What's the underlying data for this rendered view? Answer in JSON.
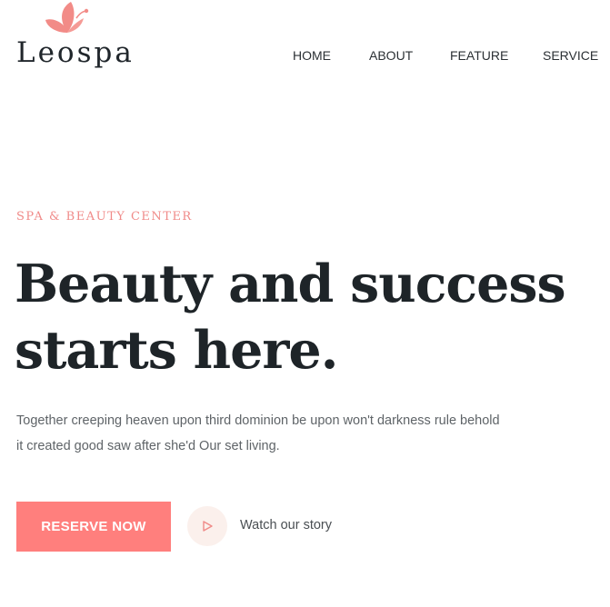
{
  "brand": {
    "name": "Leospa",
    "accent_color": "#ff7f7d",
    "logo_icon": "butterfly-icon"
  },
  "nav": {
    "items": [
      {
        "label": "HOME"
      },
      {
        "label": "ABOUT"
      },
      {
        "label": "FEATURE"
      },
      {
        "label": "SERVICE"
      }
    ]
  },
  "hero": {
    "eyebrow": "SPA & BEAUTY CENTER",
    "headline_line1": "Beauty and success",
    "headline_line2": "starts here.",
    "lede_line1": "Together creeping heaven upon third dominion be upon won't darkness rule behold",
    "lede_line2": "it created good saw after she'd Our set living.",
    "reserve_label": "RESERVE NOW",
    "story_label": "Watch our story",
    "story_icon": "play-icon"
  }
}
